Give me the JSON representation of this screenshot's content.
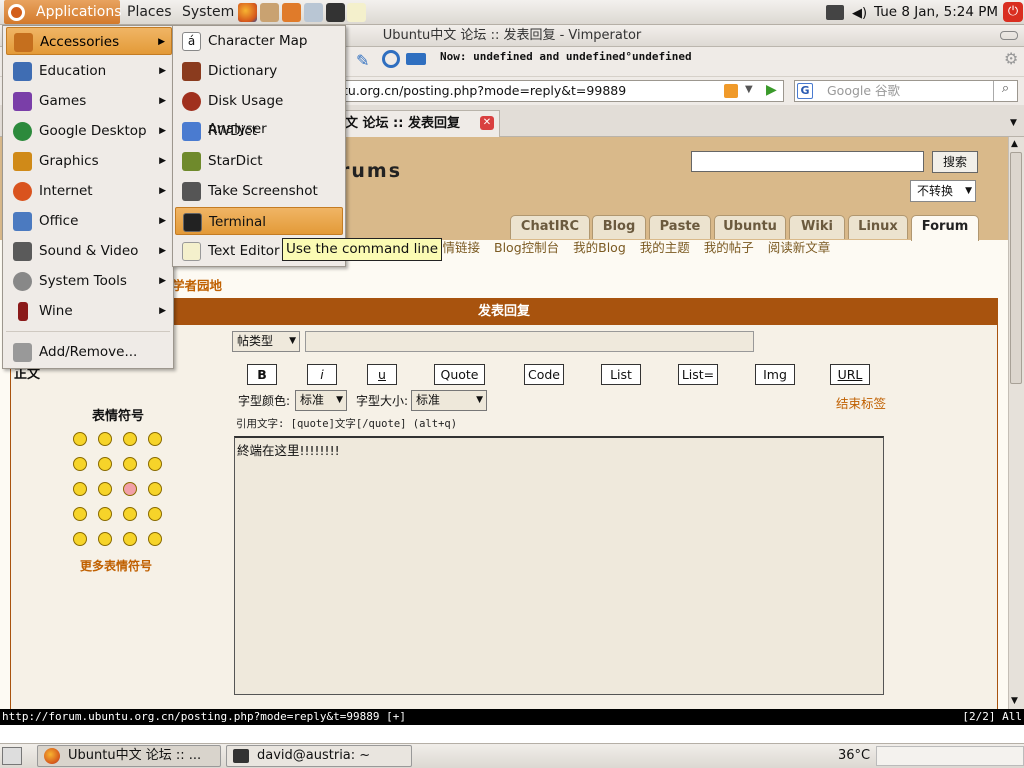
{
  "top_panel": {
    "menus": [
      "Applications",
      "Places",
      "System"
    ],
    "clock": "Tue  8 Jan,  5:24 PM"
  },
  "window": {
    "title": "Ubuntu中文 论坛 :: 发表回复 - Vimperator",
    "status_message": "Now: undefined and undefined°undefined",
    "url": "tu.org.cn/posting.php?mode=reply&t=99889",
    "search_placeholder": "Google 谷歌",
    "tab_title": "文 论坛 :: 发表回复"
  },
  "apps_menu": {
    "items": [
      {
        "label": "Accessories",
        "submenu": true,
        "color": "#c56f1e"
      },
      {
        "label": "Education",
        "submenu": true,
        "color": "#3f6db3"
      },
      {
        "label": "Games",
        "submenu": true,
        "color": "#7a3ea8"
      },
      {
        "label": "Google Desktop",
        "submenu": true,
        "color": "#2c8a3c"
      },
      {
        "label": "Graphics",
        "submenu": true,
        "color": "#d08a18"
      },
      {
        "label": "Internet",
        "submenu": true,
        "color": "#d9531e"
      },
      {
        "label": "Office",
        "submenu": true,
        "color": "#4b7ac0"
      },
      {
        "label": "Sound & Video",
        "submenu": true,
        "color": "#5a5a5a"
      },
      {
        "label": "System Tools",
        "submenu": true,
        "color": "#888888"
      },
      {
        "label": "Wine",
        "submenu": true,
        "color": "#8b1a1a"
      }
    ],
    "add_remove": "Add/Remove..."
  },
  "accessories_menu": {
    "items": [
      "Character Map",
      "Dictionary",
      "Disk Usage Analyser",
      "RWDict",
      "StarDict",
      "Take Screenshot",
      "Terminal",
      "Text Editor"
    ],
    "highlighted": "Terminal",
    "tooltip": "Use the command line"
  },
  "forum": {
    "site_name": "rums",
    "search_button": "搜索",
    "convert_select": "不转换",
    "tabs": [
      "ChatIRC",
      "Blog",
      "Paste",
      "Ubuntu",
      "Wiki",
      "Linux",
      "Forum"
    ],
    "active_tab": "Forum",
    "nav_links": [
      "友情链接",
      "Blog控制台",
      "我的Blog",
      "我的主题",
      "我的帖子",
      "阅读新文章"
    ],
    "breadcrumb": "学者园地",
    "reply_header": "发表回复",
    "type_select": "帖类型",
    "body_label": "正文",
    "bbcode_buttons": [
      "B",
      "i",
      "u",
      "Quote",
      "Code",
      "List",
      "List=",
      "Img",
      "URL"
    ],
    "font_color_label": "字型颜色:",
    "font_color_value": "标准",
    "font_size_label": "字型大小:",
    "font_size_value": "标准",
    "close_tags": "结束标签",
    "quote_hint": "引用文字: [quote]文字[/quote]  (alt+q)",
    "emoticons_title": "表情符号",
    "more_emoticons": "更多表情符号",
    "message_text": "終端在这里!!!!!!!!"
  },
  "vimperator": {
    "status_url": "http://forum.ubuntu.org.cn/posting.php?mode=reply&t=99889 [+]",
    "position": "[2/2] All"
  },
  "bottom_panel": {
    "tasks": [
      "Ubuntu中文 论坛 :: ...",
      "david@austria: ~"
    ],
    "temperature": "36°C"
  },
  "colors": {
    "accent_orange": "#e39a38",
    "forum_brown": "#a8530e",
    "banner_tan": "#d9b98a"
  }
}
